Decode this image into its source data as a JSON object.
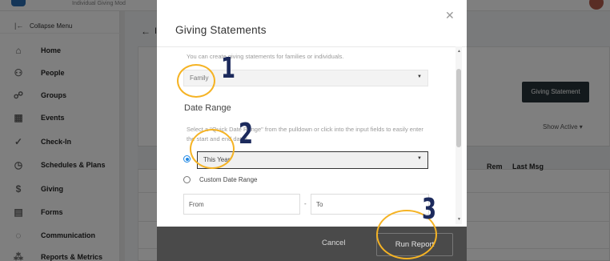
{
  "app": {
    "brand_text": "Individual Giving Mod",
    "sidebar": {
      "collapse_label": "Collapse Menu",
      "items": [
        {
          "label": "Home",
          "icon": "home-icon"
        },
        {
          "label": "People",
          "icon": "people-icon"
        },
        {
          "label": "Groups",
          "icon": "groups-icon"
        },
        {
          "label": "Events",
          "icon": "calendar-icon"
        },
        {
          "label": "Check-In",
          "icon": "check-circle-icon"
        },
        {
          "label": "Schedules & Plans",
          "icon": "clock-icon"
        },
        {
          "label": "Giving",
          "icon": "dollar-icon"
        },
        {
          "label": "Forms",
          "icon": "form-icon"
        },
        {
          "label": "Communication",
          "icon": "chat-icon"
        },
        {
          "label": "Reports & Metrics",
          "icon": "chart-icon"
        }
      ]
    },
    "content": {
      "back_letter": "I",
      "giving_statement_button": "Giving Statement",
      "show_active": "Show Active ▾",
      "columns": [
        "Rem",
        "Last Msg"
      ]
    }
  },
  "modal": {
    "title": "Giving Statements",
    "intro_text": "You can create giving statements for families or individuals.",
    "statement_type": {
      "value": "Family"
    },
    "date_range_label": "Date Range",
    "date_help": "Select a \"Quick Date Range\" from the pulldown or click into the input fields to easily enter the start and end dates.",
    "quick_range": {
      "value": "This Year"
    },
    "custom_range_label": "Custom Date Range",
    "from_placeholder": "From",
    "to_placeholder": "To",
    "cancel_label": "Cancel",
    "run_label": "Run Report"
  },
  "annotations": {
    "step1": "1",
    "step2": "2",
    "step3": "3",
    "color": "#f5b324",
    "number_color": "#1c2a5c"
  }
}
